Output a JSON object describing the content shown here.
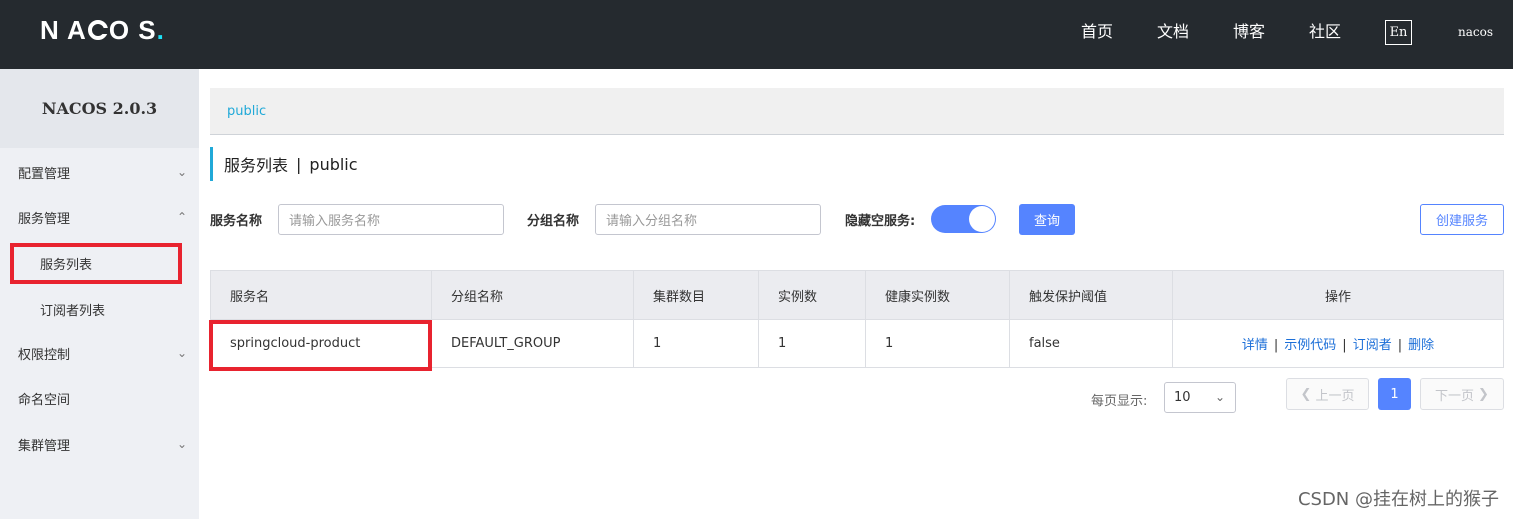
{
  "header": {
    "logo_text": "NACOS.",
    "nav": [
      "首页",
      "文档",
      "博客",
      "社区"
    ],
    "lang_button": "En",
    "user": "nacos"
  },
  "sidebar": {
    "title": "NACOS 2.0.3",
    "items": [
      {
        "label": "配置管理",
        "chevron": "down"
      },
      {
        "label": "服务管理",
        "chevron": "up"
      },
      {
        "label": "服务列表",
        "sub": true,
        "selected": true
      },
      {
        "label": "订阅者列表",
        "sub": true
      },
      {
        "label": "权限控制",
        "chevron": "down"
      },
      {
        "label": "命名空间"
      },
      {
        "label": "集群管理",
        "chevron": "down"
      }
    ]
  },
  "breadcrumb": "public",
  "page": {
    "title": "服务列表",
    "separator": "|",
    "namespace": "public"
  },
  "filters": {
    "service_name_label": "服务名称",
    "service_name_placeholder": "请输入服务名称",
    "group_name_label": "分组名称",
    "group_name_placeholder": "请输入分组名称",
    "hide_empty_label": "隐藏空服务:",
    "hide_empty_on": true,
    "query_button": "查询",
    "create_button": "创建服务"
  },
  "table": {
    "columns": [
      "服务名",
      "分组名称",
      "集群数目",
      "实例数",
      "健康实例数",
      "触发保护阈值",
      "操作"
    ],
    "rows": [
      {
        "service": "springcloud-product",
        "group": "DEFAULT_GROUP",
        "clusters": "1",
        "instances": "1",
        "healthy": "1",
        "threshold": "false",
        "ops": [
          "详情",
          "示例代码",
          "订阅者",
          "删除"
        ]
      }
    ]
  },
  "pagination": {
    "page_size_label": "每页显示:",
    "page_size": "10",
    "prev": "上一页",
    "current": "1",
    "next": "下一页"
  },
  "watermark": "CSDN @挂在树上的猴子",
  "colors": {
    "topbar": "#252a2f",
    "accent": "#5584ff",
    "highlight_box": "#e8232f",
    "link": "#1c6fd8"
  }
}
